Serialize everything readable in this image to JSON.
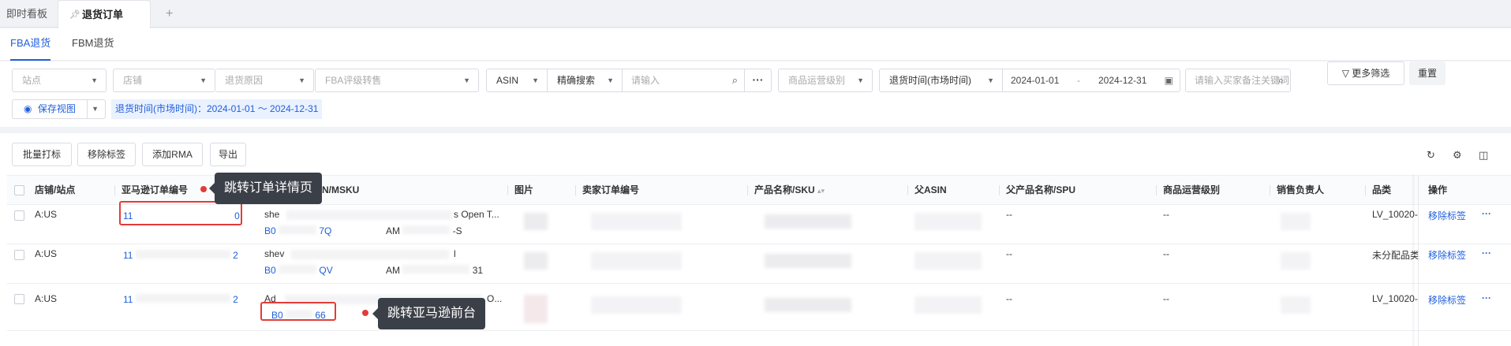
{
  "tabs": [
    {
      "label": "即时看板"
    },
    {
      "label": "退货订单",
      "active": true
    }
  ],
  "tab_add_label": "+",
  "subtabs": [
    {
      "label": "FBA退货",
      "active": true
    },
    {
      "label": "FBM退货"
    }
  ],
  "filters": {
    "site": "站点",
    "shop": "店铺",
    "reason": "退货原因",
    "fba_grade": "FBA评级转售",
    "asin_field": "ASIN",
    "search_mode": "精确搜索",
    "search_placeholder": "请输入",
    "ops_level": "商品运营级别",
    "date_type": "退货时间(市场时间)",
    "date_start": "2024-01-01",
    "date_sep": "-",
    "date_end": "2024-12-31",
    "keyword_placeholder": "请输入买家备注关键词",
    "more_filters": "更多筛选",
    "reset": "重置",
    "save_view": "保存视图",
    "active_tag": "退货时间(市场时间)：2024-01-01 ～ 2024-12-31"
  },
  "toolbar": {
    "batch_tag": "批量打标",
    "remove_tag": "移除标签",
    "add_rma": "添加RMA",
    "export": "导出"
  },
  "table": {
    "headers": {
      "shop_site": "店铺/站点",
      "amazon_order_no": "亚马逊订单编号",
      "asin_msku": "ASIN/MSKU",
      "image": "图片",
      "seller_order_no": "卖家订单编号",
      "product_sku": "产品名称/SKU",
      "parent_asin": "父ASIN",
      "parent_product_spu": "父产品名称/SPU",
      "ops_level": "商品运营级别",
      "sales_owner": "销售负责人",
      "category": "品类",
      "actions": "操作"
    },
    "rows": [
      {
        "shop_site": "A:US",
        "order_start": "11",
        "order_end": "0",
        "title_start": "she",
        "title_end": "s Open T...",
        "asin_start": "B0",
        "asin_end": "7Q",
        "msku_start": "AM",
        "msku_end": "-S",
        "parent_product_spu": "--",
        "ops_level": "--",
        "category": "LV_10020-",
        "action_remove": "移除标签",
        "action_more": "···"
      },
      {
        "shop_site": "A:US",
        "order_start": "11",
        "order_end": "2",
        "title_start": "shev",
        "title_end": "l",
        "asin_start": "B0",
        "asin_end": "QV",
        "msku_start": "AM",
        "msku_end": "31",
        "parent_product_spu": "--",
        "ops_level": "--",
        "category": "未分配品类",
        "action_remove": "移除标签",
        "action_more": "···"
      },
      {
        "shop_site": "A:US",
        "order_start": "11",
        "order_end": "2",
        "title_start": "Ad",
        "title_end": "O...",
        "asin_start": "B0",
        "asin_end": "66",
        "parent_product_spu": "--",
        "ops_level": "--",
        "category": "LV_10020-",
        "action_remove": "移除标签",
        "action_more": "···"
      }
    ]
  },
  "callouts": {
    "order_detail": "跳转订单详情页",
    "amazon_front": "跳转亚马逊前台"
  },
  "colors": {
    "accent": "#1f5fdc",
    "highlight": "#e23c39",
    "tooltip_bg": "#3b3f48"
  },
  "icons": [
    "pin-icon",
    "chevron-down-icon",
    "search-icon",
    "calendar-icon",
    "filter-icon",
    "eye-icon",
    "refresh-icon",
    "gear-icon",
    "columns-icon",
    "sort-icon"
  ]
}
